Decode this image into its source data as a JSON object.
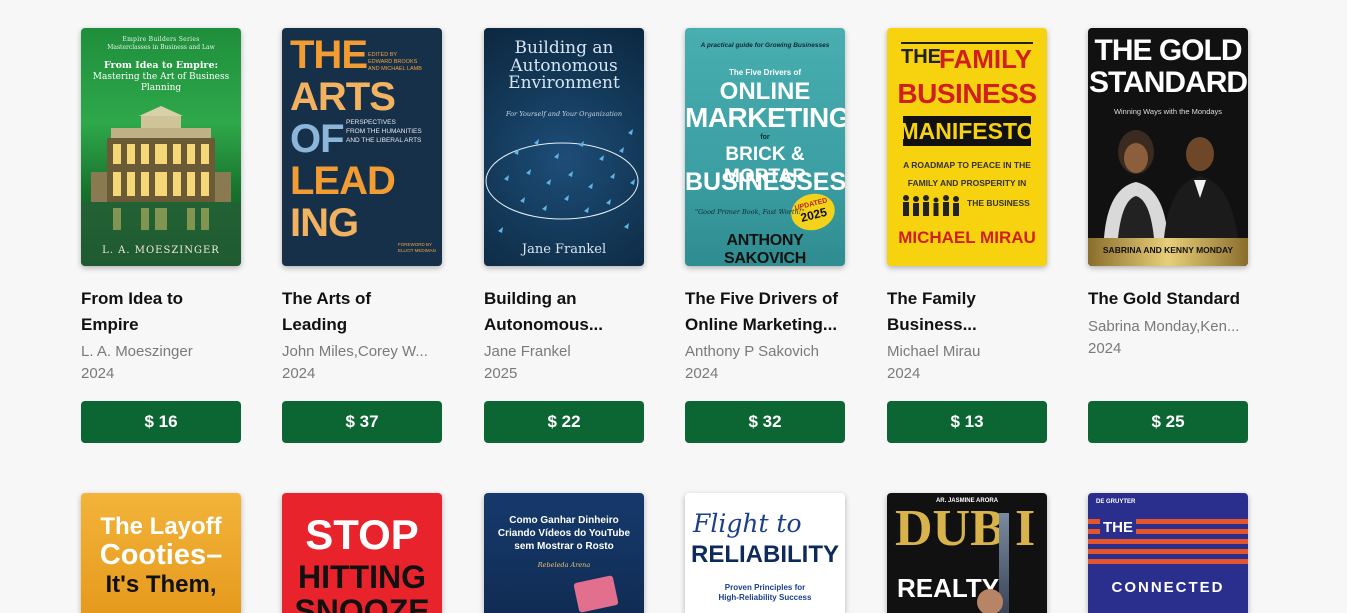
{
  "books": [
    {
      "title_line1": "From Idea to",
      "title_line2": "Empire",
      "author": "L. A. Moeszinger",
      "year": "2024",
      "price": "$ 16",
      "cover": {
        "top_small": "Empire Builders Series",
        "top_small2": "Masterclasses in Business and Law",
        "heading1": "From Idea to Empire:",
        "heading2": "Mastering the Art of Business",
        "heading3": "Planning",
        "byline": "L. A. MOESZINGER"
      }
    },
    {
      "title_line1": "The Arts of",
      "title_line2": "Leading",
      "author": "John Miles,Corey W...",
      "year": "2024",
      "price": "$ 37",
      "cover": {
        "editors1": "EDITED BY",
        "editors2": "EDWARD BROOKS",
        "editors3": "AND MICHAEL LAMB",
        "big1": "THE",
        "big2": "ARTS",
        "big3": "OF",
        "big4": "LEAD",
        "big5": "ING",
        "sub1": "PERSPECTIVES",
        "sub2": "FROM THE HUMANITIES",
        "sub3": "AND THE LIBERAL ARTS",
        "foreword1": "FOREWORD BY",
        "foreword2": "ELLIOT MEDIMAN"
      }
    },
    {
      "title_line1": "Building an",
      "title_line2": "Autonomous...",
      "author": "Jane Frankel",
      "year": "2025",
      "price": "$ 22",
      "cover": {
        "t1": "Building an",
        "t2": "Autonomous",
        "t3": "Environment",
        "sub": "For Yourself and Your Organization",
        "byline": "Jane Frankel"
      }
    },
    {
      "title_line1": "The Five Drivers of",
      "title_line2": "Online Marketing...",
      "author": "Anthony P Sakovich",
      "year": "2024",
      "price": "$ 32",
      "cover": {
        "tagline": "A practical guide for Growing Businesses",
        "pre": "The Five Drivers of",
        "b1": "ONLINE",
        "b2": "MARKETING",
        "for": "for",
        "b3": "BRICK & MORTAR",
        "b4": "BUSINESSES",
        "badge1": "UPDATED",
        "badge2": "2025",
        "quote": "\"Good Primer Book, Fast Worth!\"",
        "byline": "ANTHONY SAKOVICH"
      }
    },
    {
      "title_line1": "The Family",
      "title_line2": "Business...",
      "author": "Michael Mirau",
      "year": "2024",
      "price": "$ 13",
      "cover": {
        "the": "THE",
        "family": "FAMILY",
        "business": "BUSINESS",
        "manifesto": "MANIFESTO",
        "l1": "A ROADMAP TO PEACE IN THE",
        "l2": "FAMILY AND PROSPERITY IN",
        "l3": "THE BUSINESS",
        "byline": "MICHAEL MIRAU"
      }
    },
    {
      "title_line1": "The Gold Standard",
      "title_line2": "",
      "author": "Sabrina Monday,Ken...",
      "year": "2024",
      "price": "$ 25",
      "cover": {
        "t1": "THE GOLD",
        "t2": "STANDARD",
        "sub": "Winning Ways with the Mondays",
        "byline": "SABRINA AND KENNY MONDAY"
      }
    }
  ],
  "row2": [
    {
      "l1": "The Layoff",
      "l2": "Cooties–",
      "l3": "It's Them,"
    },
    {
      "l1": "STOP",
      "l2": "HITTING",
      "l3": "SNOOZE"
    },
    {
      "l1": "Como Ganhar Dinheiro",
      "l2": "Criando Vídeos do YouTube",
      "l3": "sem Mostrar o Rosto",
      "l4": "Rebeleda Arena"
    },
    {
      "l1": "Flight to",
      "l2": "RELIABILITY",
      "l3": "Proven Principles for",
      "l4": "High-Reliability Success"
    },
    {
      "l0": "AR. JASMINE ARORA",
      "l1": "DUB",
      "l2": "I",
      "l3": "REALTY"
    },
    {
      "l0": "DE GRUYTER",
      "l1": "THE",
      "l2": "CONNECTED"
    }
  ]
}
